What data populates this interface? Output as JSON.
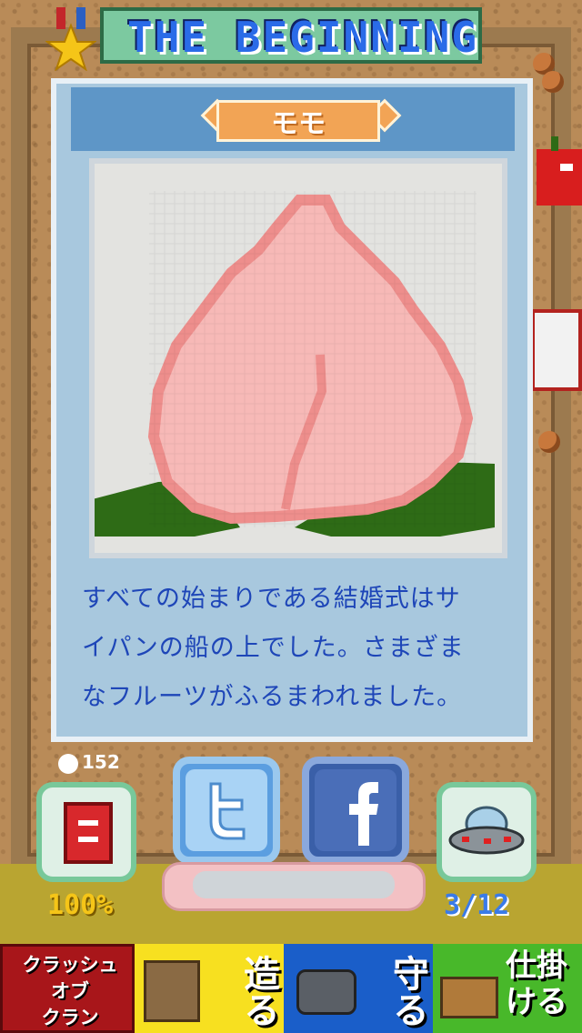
{
  "header": {
    "title": "THE BEGINNING"
  },
  "card": {
    "name": "モモ",
    "description_lines": [
      "すべての始まりである結婚式はサ",
      "イパンの船の上でした。さまざま",
      "なフルーツがふるまわれました。"
    ]
  },
  "footer": {
    "coin_count": "152",
    "left_stat": "100%",
    "right_stat": "3/12"
  },
  "banner": {
    "brand": "クラッシュ\nオブ\nクラン",
    "items": [
      "造る",
      "守る",
      "仕掛ける"
    ]
  },
  "colors": {
    "title_blue": "#2a6be8",
    "card_blue": "#5e96c7",
    "text_blue": "#1e46b8",
    "peach_fill": "#f7b9b7",
    "peach_outline": "#ee8e8c",
    "leaf_green": "#2e6b16"
  }
}
